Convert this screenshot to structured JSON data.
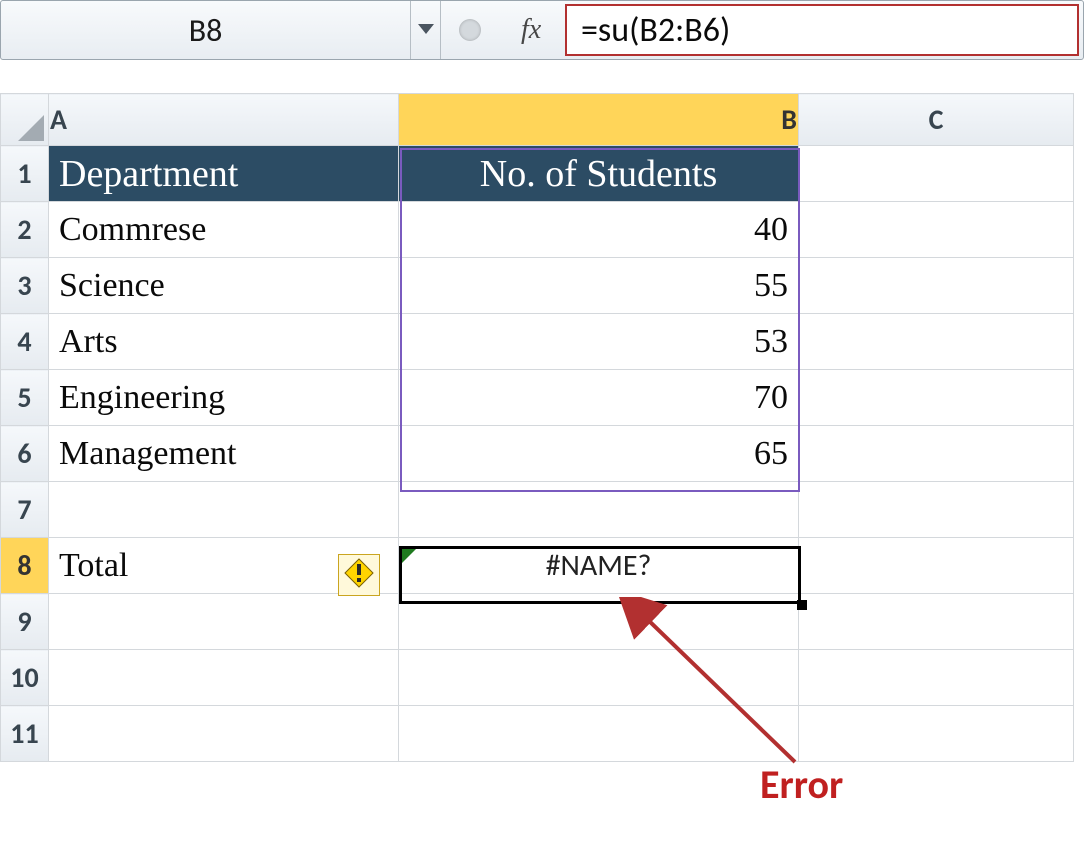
{
  "formula_bar": {
    "cell_ref": "B8",
    "fx_label": "fx",
    "formula": "=su(B2:B6)"
  },
  "columns": {
    "A": "A",
    "B": "B",
    "C": "C"
  },
  "rows": [
    "1",
    "2",
    "3",
    "4",
    "5",
    "6",
    "7",
    "8",
    "9",
    "10",
    "11"
  ],
  "data_header": {
    "A": "Department",
    "B": "No. of Students"
  },
  "data_rows": [
    {
      "A": "Commrese",
      "B": "40"
    },
    {
      "A": "Science",
      "B": "55"
    },
    {
      "A": "Arts",
      "B": "53"
    },
    {
      "A": "Engineering",
      "B": "70"
    },
    {
      "A": "Management",
      "B": "65"
    }
  ],
  "total_row": {
    "A": "Total",
    "B": "#NAME?"
  },
  "selection": {
    "cell": "B8",
    "range": "B2:B7"
  },
  "annotation": {
    "label": "Error"
  },
  "colors": {
    "header_bg": "#2c4c64",
    "active_tab": "#ffd559",
    "formula_box_border": "#b23030",
    "range_border": "#7a5bbf",
    "annotation": "#c02020"
  },
  "icons": {
    "dropdown": "chevron-down-icon",
    "fx": "fx-icon",
    "error_trace": "warning-diamond-icon",
    "trace_triangle": "error-triangle-icon"
  }
}
